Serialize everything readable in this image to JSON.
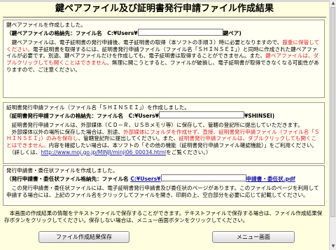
{
  "title": "鍵ペアファイル及び証明書発行申請ファイル作成結果",
  "section1": {
    "heading": "鍵ペアファイルを作成しました。",
    "path_label": "（鍵ペアファイルの格納先：ファイル名　C:¥Users¥",
    "path_suffix": "鍵ペア)",
    "p1_a": "　鍵ペアファイルは、電子証明書の発行申請後、電子証明書の取得（本ソフトの手順３）時に必要となりますので、",
    "p1_red1": "厳重に保管してください。",
    "p1_b": "電子証明書を取得するには、証明書発行申請ファイル（ファイル名「ＳＨＩＮＳＥＩ」）と同時に作成された鍵ペアファイルが必要です。別途、鍵ペアファイルだけを作成しても、電子証明書は取得することができません。また、",
    "p1_red2": "鍵ペアファイルは、ダブルクリックしても開くことはできません。",
    "p1_c": "無理に開こうとすると、ファイルが破損し、電子証明書が取得できなくなる可能性がありますので、ご注意ください。"
  },
  "section2": {
    "heading": "証明書発行申請ファイル（ファイル名「ＳＨＩＮＳＥＩ」）を作成しました。",
    "path_label": "（証明書発行申請ファイルの格納先：ファイル名　C:¥Users¥",
    "path_suffix": "¥SHINSEI)",
    "p1": "　証明書発行申請ファイルは、外部媒体（ＣＤ－Ｒ、ＵＳＢメモリ等）に保存して、管轄の登記所に提出していただきます。",
    "p2_a": "　外部媒体以外の場所に保存した場合は、別途、",
    "p2_red1": "外部媒体にフォルダを作成せず、直接、証明書発行申請ファイル（ファイル名「ＳＨＩＮＳＥＩ」）のみを保存し",
    "p2_b": "、管轄登記所に提出してください。また、",
    "p2_red2": "証明書発行申請ファイルは、ダブルクリックしても開くことはできません。",
    "p2_c": "内容を確認したい場合は、本ソフトの「その他の機能（証明書発行申請ファイル確認機能）」をご利用ください。",
    "p3_a": "　（詳しくは、",
    "p3_link": "http://www.moj.go.jp/MINJI/minji06_00034.html",
    "p3_b": "をご覧ください。）"
  },
  "section3": {
    "heading": "発行申請書・委任状ファイルを作成しました。",
    "path_label": "（発行申請書・委任状ファイル格納先：ファイル名",
    "path_value": "C:¥Users¥",
    "path_suffix": "申請書・委任状.pdf",
    "p1": "　この発行申請書・委任状ファイルには、電子証明書発行申請書及び委任状のページがあります。このファイルのページを利用して申請する場合には、上記のファイル名をクリックしてファイルを開き、印刷の上、空白部分を必要に応じて記載してください。"
  },
  "note": "　本画面の作成結果の情報をテキストファイルで保存することができます。テキストファイルで保存する場合は、ファイル作成結果保存ボタンをクリックしてください。保存しない場合は、メニュー画面ボタンをクリックしてください。",
  "buttons": {
    "save": "ファイル作成結果保存",
    "menu": "メニュー画面"
  }
}
